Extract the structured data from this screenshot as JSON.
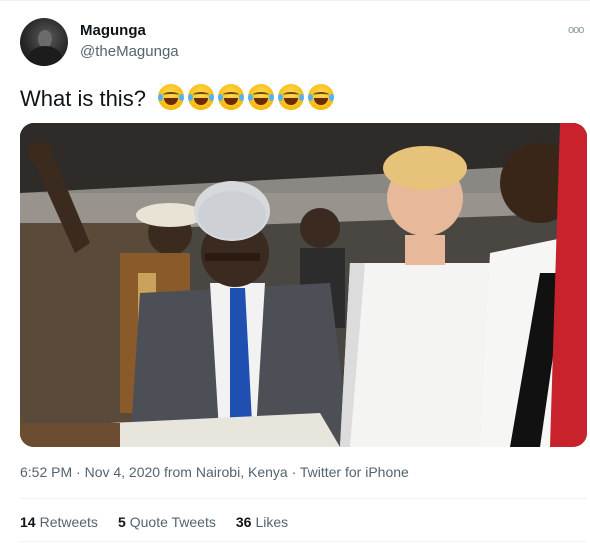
{
  "tweet": {
    "author_name": "Magunga",
    "author_handle": "@theMagunga",
    "more_icon": "ooo",
    "text": "What is this?",
    "emoji_count": 6,
    "emoji_name": "face-with-tears-of-joy",
    "timestamp": "6:52 PM · Nov 4, 2020 from Nairobi, Kenya · Twitter for iPhone",
    "stats": [
      {
        "count": "14",
        "label": "Retweets"
      },
      {
        "count": "5",
        "label": "Quote Tweets"
      },
      {
        "count": "36",
        "label": "Likes"
      }
    ]
  }
}
